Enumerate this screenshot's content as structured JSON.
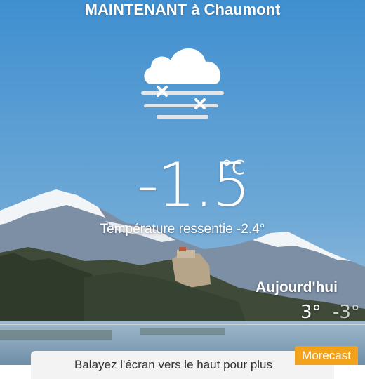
{
  "header": {
    "title": "MAINTENANT à Chaumont"
  },
  "current": {
    "icon": "cloud-fog-icon",
    "temperature": "-1.5",
    "unit": "°C",
    "feels_like": "Température ressentie -2.4°"
  },
  "today": {
    "label": "Aujourd'hui",
    "high": "3°",
    "low": "-3°"
  },
  "panel": {
    "text": "Balayez l'écran vers le haut pour plus"
  },
  "brand": {
    "label": "Morecast"
  },
  "colors": {
    "sky_top": "#3f8fd0",
    "accent": "#f3a31b"
  }
}
